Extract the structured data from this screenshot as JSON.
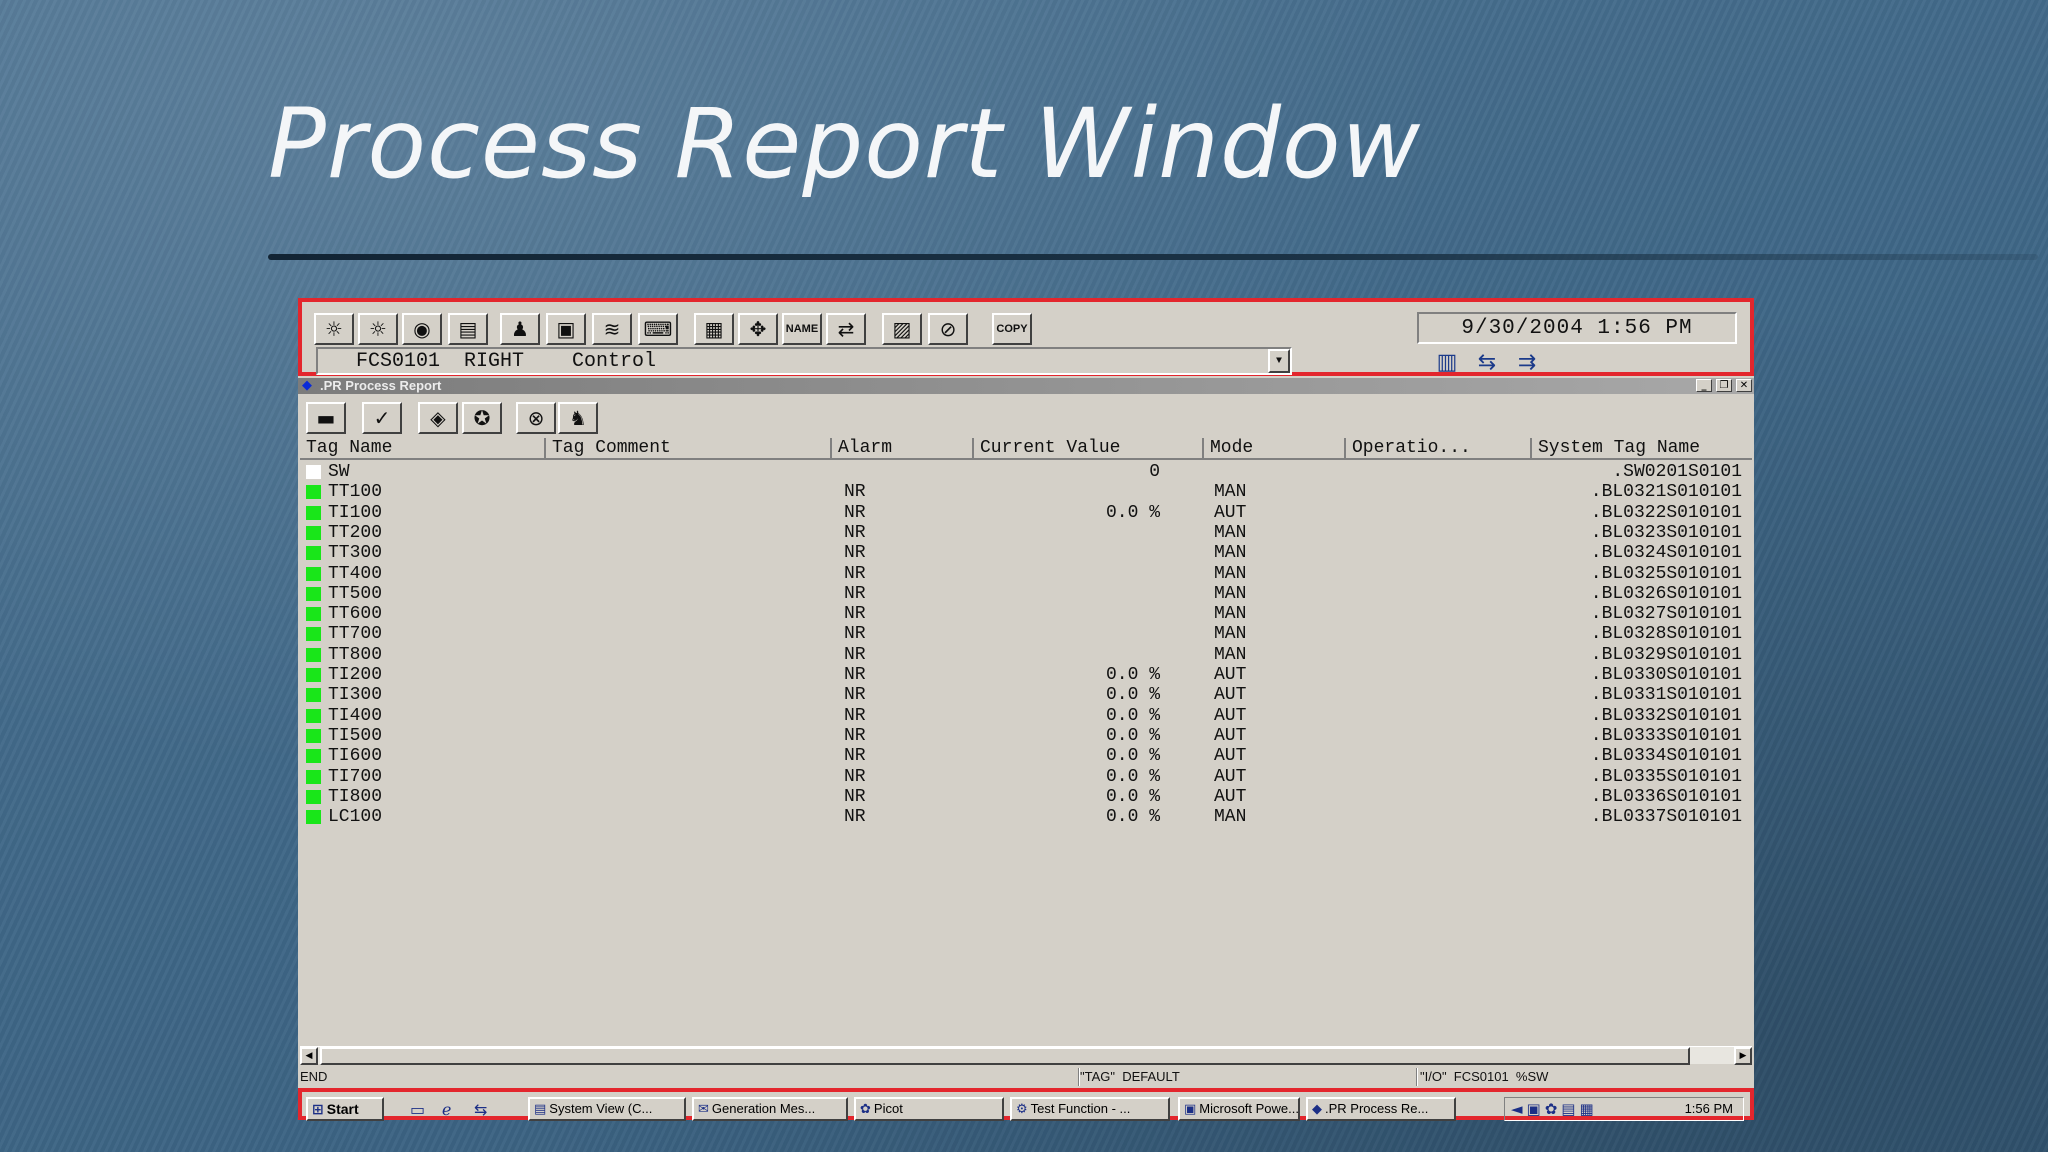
{
  "slide": {
    "title": "Process Report Window"
  },
  "system_bar": {
    "datetime": "9/30/2004 1:56 PM",
    "window_name": {
      "station": "FCS0101",
      "position": "RIGHT",
      "view": "Control"
    },
    "toolbar_buttons": [
      {
        "name": "process-alarm-icon",
        "glyph": "☼"
      },
      {
        "name": "system-alarm-icon",
        "glyph": "☼"
      },
      {
        "name": "operator-guide-icon",
        "glyph": "◉"
      },
      {
        "name": "message-monitor-icon",
        "glyph": "▤"
      },
      {
        "name": "operator-icon",
        "glyph": "♟"
      },
      {
        "name": "tool-box-icon",
        "glyph": "▣"
      },
      {
        "name": "trend-icon",
        "glyph": "≋"
      },
      {
        "name": "keyboard-icon",
        "glyph": "⌨"
      },
      {
        "name": "preset-menu-icon",
        "glyph": "▦"
      },
      {
        "name": "navigator-icon",
        "glyph": "✥"
      },
      {
        "name": "name-input-label",
        "glyph": "NAME"
      },
      {
        "name": "circulate-icon",
        "glyph": "⇄"
      },
      {
        "name": "clear-screen-icon",
        "glyph": "▨"
      },
      {
        "name": "buzzer-reset-icon",
        "glyph": "⊘"
      },
      {
        "name": "copy-label",
        "glyph": "COPY"
      }
    ],
    "status_icons": [
      "▥",
      "⇆",
      "⇉"
    ]
  },
  "report_window": {
    "title": ".PR Process Report",
    "toolbar_buttons": [
      {
        "name": "print-icon",
        "glyph": "▬"
      },
      {
        "name": "check-icon",
        "glyph": "✓"
      },
      {
        "name": "tag-icon",
        "glyph": "◈"
      },
      {
        "name": "tag-search-icon",
        "glyph": "✪"
      },
      {
        "name": "io-icon",
        "glyph": "⊗"
      },
      {
        "name": "search-icon",
        "glyph": "♞"
      }
    ],
    "columns": [
      "Tag Name",
      "Tag Comment",
      "Alarm",
      "Current Value",
      "Mode",
      "Operatio...",
      "System Tag Name"
    ],
    "rows": [
      {
        "tag": "SW",
        "comment": "",
        "alarm": "",
        "value": "0",
        "mode": "",
        "system_tag": ".SW0201S0101",
        "status_color": "#ffffff"
      },
      {
        "tag": "TT100",
        "comment": "",
        "alarm": "NR",
        "value": "",
        "mode": "MAN",
        "system_tag": ".BL0321S010101",
        "status_color": "#19e619"
      },
      {
        "tag": "TI100",
        "comment": "",
        "alarm": "NR",
        "value": "0.0 %",
        "mode": "AUT",
        "system_tag": ".BL0322S010101",
        "status_color": "#19e619"
      },
      {
        "tag": "TT200",
        "comment": "",
        "alarm": "NR",
        "value": "",
        "mode": "MAN",
        "system_tag": ".BL0323S010101",
        "status_color": "#19e619"
      },
      {
        "tag": "TT300",
        "comment": "",
        "alarm": "NR",
        "value": "",
        "mode": "MAN",
        "system_tag": ".BL0324S010101",
        "status_color": "#19e619"
      },
      {
        "tag": "TT400",
        "comment": "",
        "alarm": "NR",
        "value": "",
        "mode": "MAN",
        "system_tag": ".BL0325S010101",
        "status_color": "#19e619"
      },
      {
        "tag": "TT500",
        "comment": "",
        "alarm": "NR",
        "value": "",
        "mode": "MAN",
        "system_tag": ".BL0326S010101",
        "status_color": "#19e619"
      },
      {
        "tag": "TT600",
        "comment": "",
        "alarm": "NR",
        "value": "",
        "mode": "MAN",
        "system_tag": ".BL0327S010101",
        "status_color": "#19e619"
      },
      {
        "tag": "TT700",
        "comment": "",
        "alarm": "NR",
        "value": "",
        "mode": "MAN",
        "system_tag": ".BL0328S010101",
        "status_color": "#19e619"
      },
      {
        "tag": "TT800",
        "comment": "",
        "alarm": "NR",
        "value": "",
        "mode": "MAN",
        "system_tag": ".BL0329S010101",
        "status_color": "#19e619"
      },
      {
        "tag": "TI200",
        "comment": "",
        "alarm": "NR",
        "value": "0.0 %",
        "mode": "AUT",
        "system_tag": ".BL0330S010101",
        "status_color": "#19e619"
      },
      {
        "tag": "TI300",
        "comment": "",
        "alarm": "NR",
        "value": "0.0 %",
        "mode": "AUT",
        "system_tag": ".BL0331S010101",
        "status_color": "#19e619"
      },
      {
        "tag": "TI400",
        "comment": "",
        "alarm": "NR",
        "value": "0.0 %",
        "mode": "AUT",
        "system_tag": ".BL0332S010101",
        "status_color": "#19e619"
      },
      {
        "tag": "TI500",
        "comment": "",
        "alarm": "NR",
        "value": "0.0 %",
        "mode": "AUT",
        "system_tag": ".BL0333S010101",
        "status_color": "#19e619"
      },
      {
        "tag": "TI600",
        "comment": "",
        "alarm": "NR",
        "value": "0.0 %",
        "mode": "AUT",
        "system_tag": ".BL0334S010101",
        "status_color": "#19e619"
      },
      {
        "tag": "TI700",
        "comment": "",
        "alarm": "NR",
        "value": "0.0 %",
        "mode": "AUT",
        "system_tag": ".BL0335S010101",
        "status_color": "#19e619"
      },
      {
        "tag": "TI800",
        "comment": "",
        "alarm": "NR",
        "value": "0.0 %",
        "mode": "AUT",
        "system_tag": ".BL0336S010101",
        "status_color": "#19e619"
      },
      {
        "tag": "LC100",
        "comment": "",
        "alarm": "NR",
        "value": "0.0 %",
        "mode": "MAN",
        "system_tag": ".BL0337S010101",
        "status_color": "#19e619"
      }
    ],
    "status": {
      "left": "END",
      "tag_mode": "\"TAG\"  DEFAULT",
      "io": "\"I/O\"  FCS0101  %SW"
    }
  },
  "taskbar": {
    "start_label": "Start",
    "tasks": [
      {
        "label": "System View (C...",
        "icon": "▤"
      },
      {
        "label": "Generation Mes...",
        "icon": "✉"
      },
      {
        "label": "Picot",
        "icon": "✿"
      },
      {
        "label": "Test Function - ...",
        "icon": "⚙"
      },
      {
        "label": "Microsoft Powe...",
        "icon": "▣"
      },
      {
        "label": ".PR Process Re...",
        "icon": "◆"
      }
    ],
    "clock": "1:56 PM"
  },
  "colors": {
    "accent_highlight": "#e3262d",
    "window_face": "#d4d0c8",
    "status_green": "#19e619"
  }
}
